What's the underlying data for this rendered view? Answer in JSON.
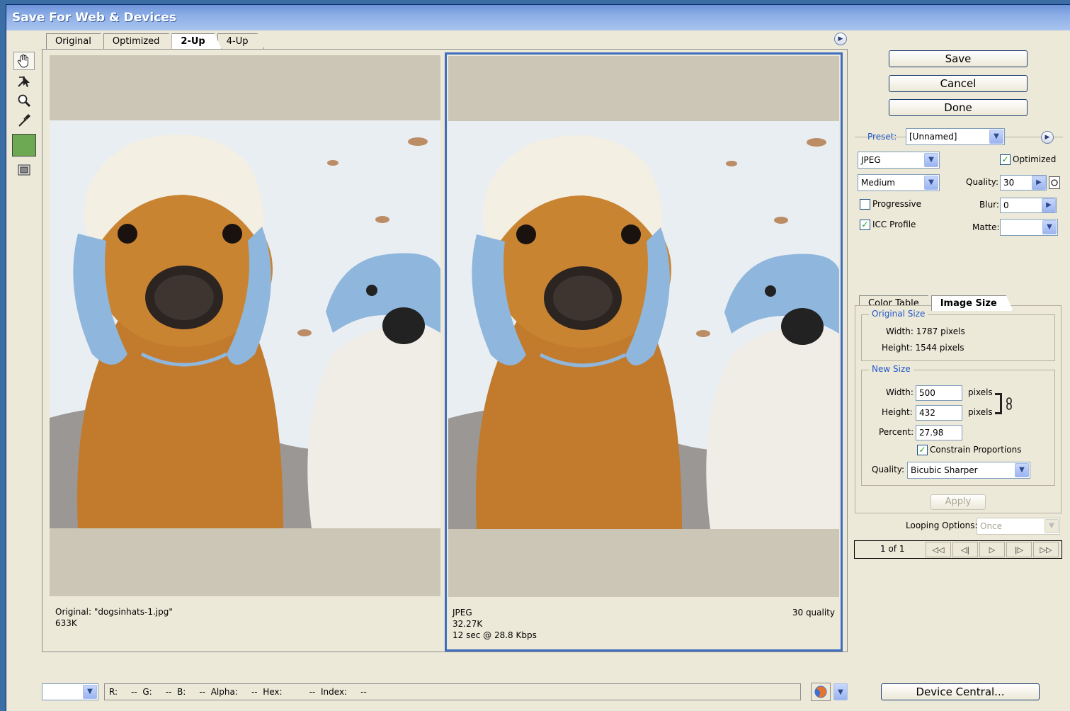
{
  "window": {
    "title": "Save For Web & Devices"
  },
  "view_tabs": [
    {
      "label": "Original"
    },
    {
      "label": "Optimized"
    },
    {
      "label": "2-Up"
    },
    {
      "label": "4-Up"
    }
  ],
  "active_view_tab": "2-Up",
  "tools": [
    "hand-tool-icon",
    "slice-select-tool-icon",
    "zoom-tool-icon",
    "eyedropper-tool-icon"
  ],
  "eyedropper_color": "#6da952",
  "panes": {
    "original": {
      "line1": "Original: \"dogsinhats-1.jpg\"",
      "line2": "633K"
    },
    "optimized": {
      "format": "JPEG",
      "size": "32.27K",
      "download": "12 sec @ 28.8 Kbps",
      "quality": "30 quality"
    }
  },
  "buttons": {
    "save": "Save",
    "cancel": "Cancel",
    "done": "Done",
    "apply": "Apply",
    "device_central": "Device Central..."
  },
  "settings": {
    "preset_label": "Preset:",
    "preset_value": "[Unnamed]",
    "format_value": "JPEG",
    "quality_level_value": "Medium",
    "optimized_label": "Optimized",
    "optimized_checked": true,
    "quality_label": "Quality:",
    "quality_value": "30",
    "progressive_label": "Progressive",
    "progressive_checked": false,
    "blur_label": "Blur:",
    "blur_value": "0",
    "icc_label": "ICC Profile",
    "icc_checked": true,
    "matte_label": "Matte:"
  },
  "lower_tabs": [
    {
      "label": "Color Table"
    },
    {
      "label": "Image Size"
    }
  ],
  "active_lower_tab": "Image Size",
  "image_size": {
    "original_title": "Original Size",
    "original_width": "Width:  1787 pixels",
    "original_height": "Height:  1544 pixels",
    "new_title": "New Size",
    "width_label": "Width:",
    "width_value": "500",
    "height_label": "Height:",
    "height_value": "432",
    "percent_label": "Percent:",
    "percent_value": "27.98",
    "unit": "pixels",
    "constrain_label": "Constrain Proportions",
    "constrain_checked": true,
    "quality_label": "Quality:",
    "quality_value": "Bicubic Sharper"
  },
  "animation": {
    "looping_label": "Looping Options:",
    "looping_value": "Once",
    "frame_counter": "1 of 1"
  },
  "statusbar": {
    "text": "R:     --  G:     --  B:     --  Alpha:     --  Hex:          --  Index:     --"
  },
  "colors": {
    "accent": "#3d6ebf",
    "title_gradient_start": "#6e93d9",
    "group_title": "#2158c8"
  }
}
